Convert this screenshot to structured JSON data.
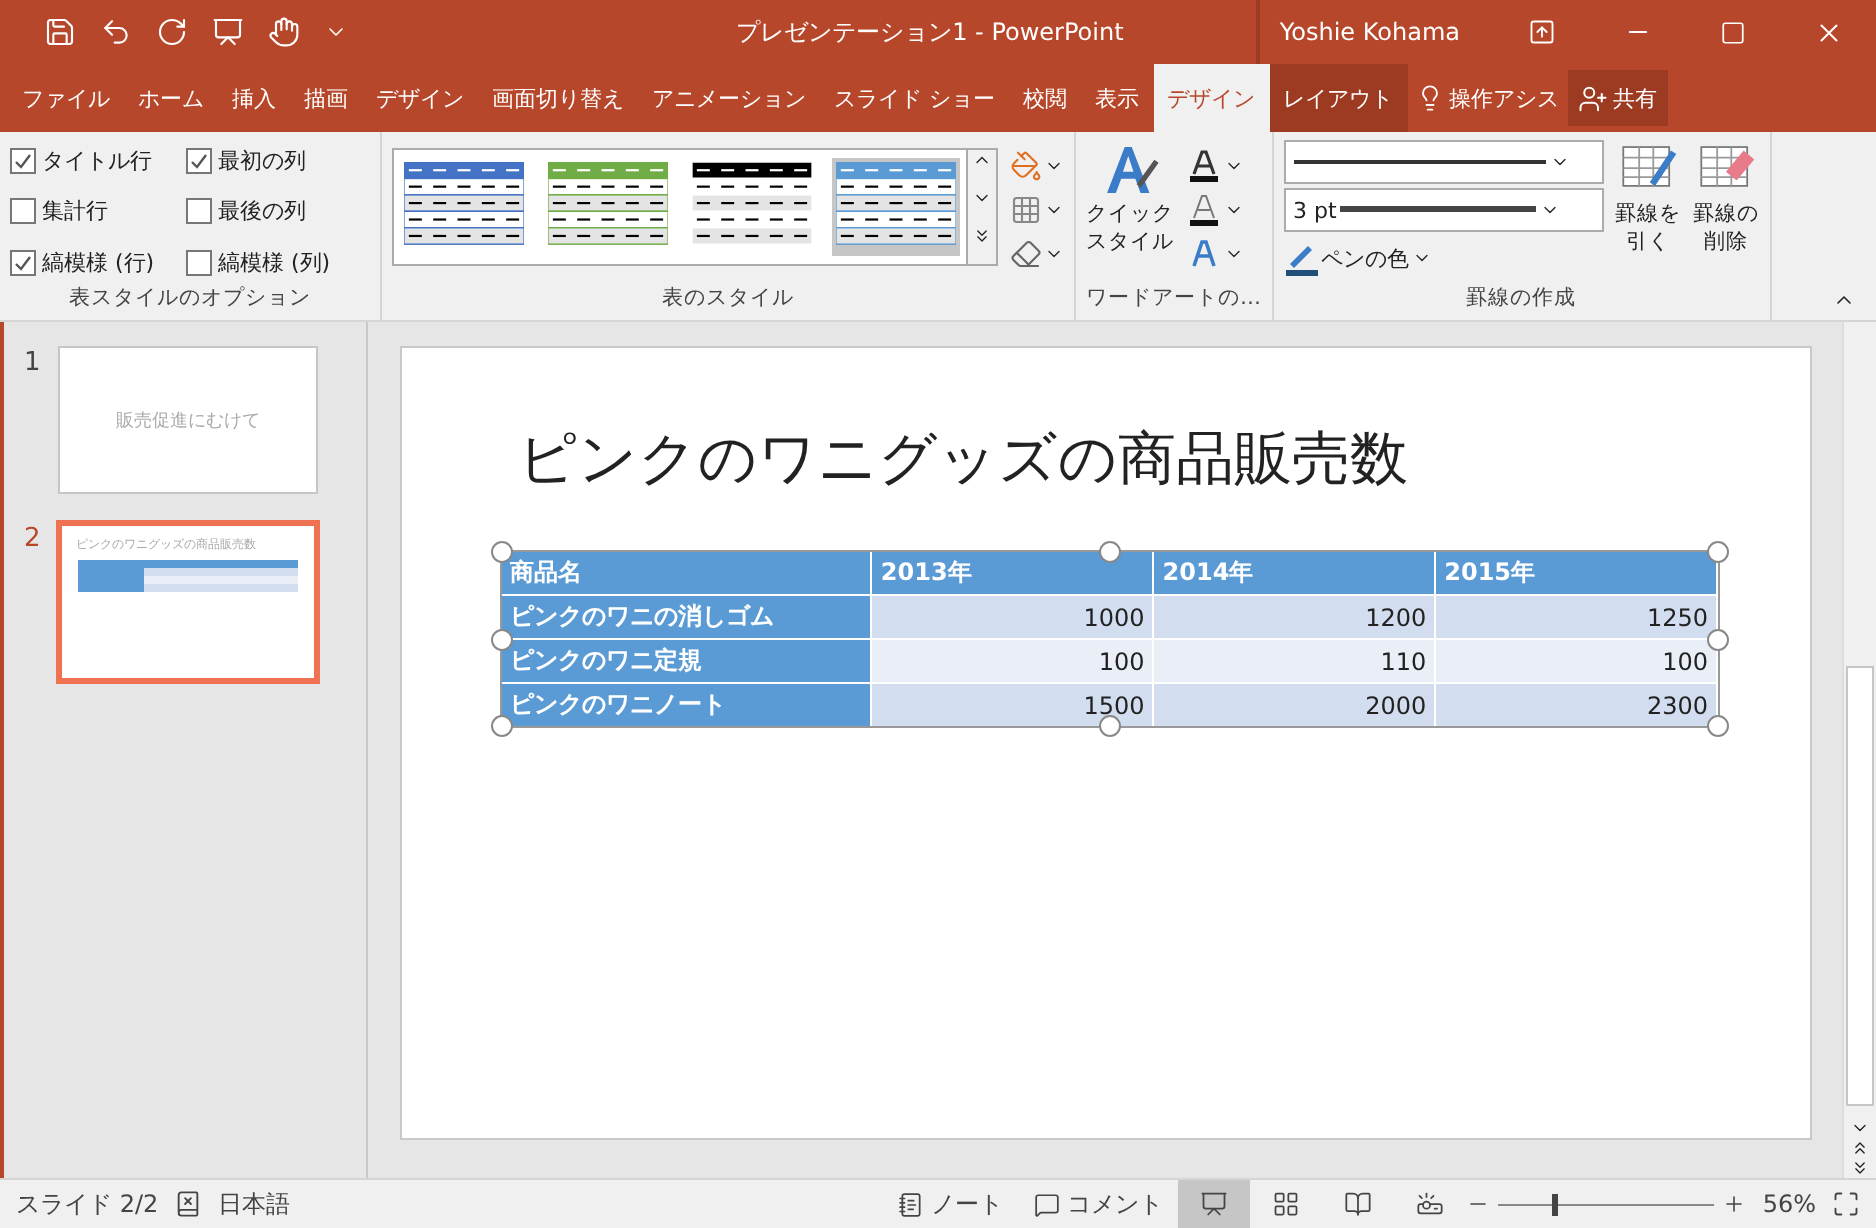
{
  "window": {
    "title": "プレゼンテーション1 - PowerPoint",
    "user": "Yoshie Kohama"
  },
  "tabs": [
    {
      "label": "ファイル",
      "selected": false,
      "kind": "normal"
    },
    {
      "label": "ホーム",
      "selected": false,
      "kind": "normal"
    },
    {
      "label": "挿入",
      "selected": false,
      "kind": "normal"
    },
    {
      "label": "描画",
      "selected": false,
      "kind": "normal"
    },
    {
      "label": "デザイン",
      "selected": false,
      "kind": "normal"
    },
    {
      "label": "画面切り替え",
      "selected": false,
      "kind": "normal"
    },
    {
      "label": "アニメーション",
      "selected": false,
      "kind": "normal"
    },
    {
      "label": "スライド ショー",
      "selected": false,
      "kind": "normal"
    },
    {
      "label": "校閲",
      "selected": false,
      "kind": "normal"
    },
    {
      "label": "表示",
      "selected": false,
      "kind": "normal"
    },
    {
      "label": "デザイン",
      "selected": true,
      "kind": "contextual"
    },
    {
      "label": "レイアウト",
      "selected": false,
      "kind": "contextual"
    }
  ],
  "tell_me": "操作アシス",
  "share": "共有",
  "ribbon": {
    "style_options": {
      "label": "表スタイルのオプション",
      "options": [
        {
          "label": "タイトル行",
          "checked": true
        },
        {
          "label": "最初の列",
          "checked": true
        },
        {
          "label": "集計行",
          "checked": false
        },
        {
          "label": "最後の列",
          "checked": false
        },
        {
          "label": "縞模様 (行)",
          "checked": true
        },
        {
          "label": "縞模様 (列)",
          "checked": false
        }
      ]
    },
    "table_styles": {
      "label": "表のスタイル",
      "styles": [
        {
          "color": "#4472c4",
          "selected": false
        },
        {
          "color": "#70ad47",
          "selected": false
        },
        {
          "color": "#000000",
          "selected": false
        },
        {
          "color": "#5b9bd5",
          "selected": true
        }
      ]
    },
    "wordart": {
      "label": "ワードアートの…",
      "quick_style": [
        "クイック",
        "スタイル"
      ]
    },
    "borders": {
      "label": "罫線の作成",
      "pen_weight": "3 pt",
      "pen_color": "ペンの色",
      "draw": [
        "罫線を",
        "引く"
      ],
      "erase": [
        "罫線の",
        "削除"
      ]
    }
  },
  "slides": [
    {
      "number": "1",
      "selected": false,
      "title": "販売促進にむけて"
    },
    {
      "number": "2",
      "selected": true,
      "title": "ピンクのワニグッズの商品販売数"
    }
  ],
  "slide": {
    "title": "ピンクのワニグッズの商品販売数",
    "table": {
      "columns": [
        "商品名",
        "2013年",
        "2014年",
        "2015年"
      ],
      "rows": [
        [
          "ピンクのワニの消しゴム",
          "1000",
          "1200",
          "1250"
        ],
        [
          "ピンクのワニ定規",
          "100",
          "110",
          "100"
        ],
        [
          "ピンクのワニノート",
          "1500",
          "2000",
          "2300"
        ]
      ]
    }
  },
  "status_bar": {
    "slide": "スライド 2/2",
    "language": "日本語",
    "notes": "ノート",
    "comments": "コメント",
    "views": [
      {
        "selected": true
      },
      {
        "selected": false
      },
      {
        "selected": false
      },
      {
        "selected": false
      }
    ],
    "zoom": {
      "level": 0.26
    },
    "zoom_text": "56%"
  }
}
